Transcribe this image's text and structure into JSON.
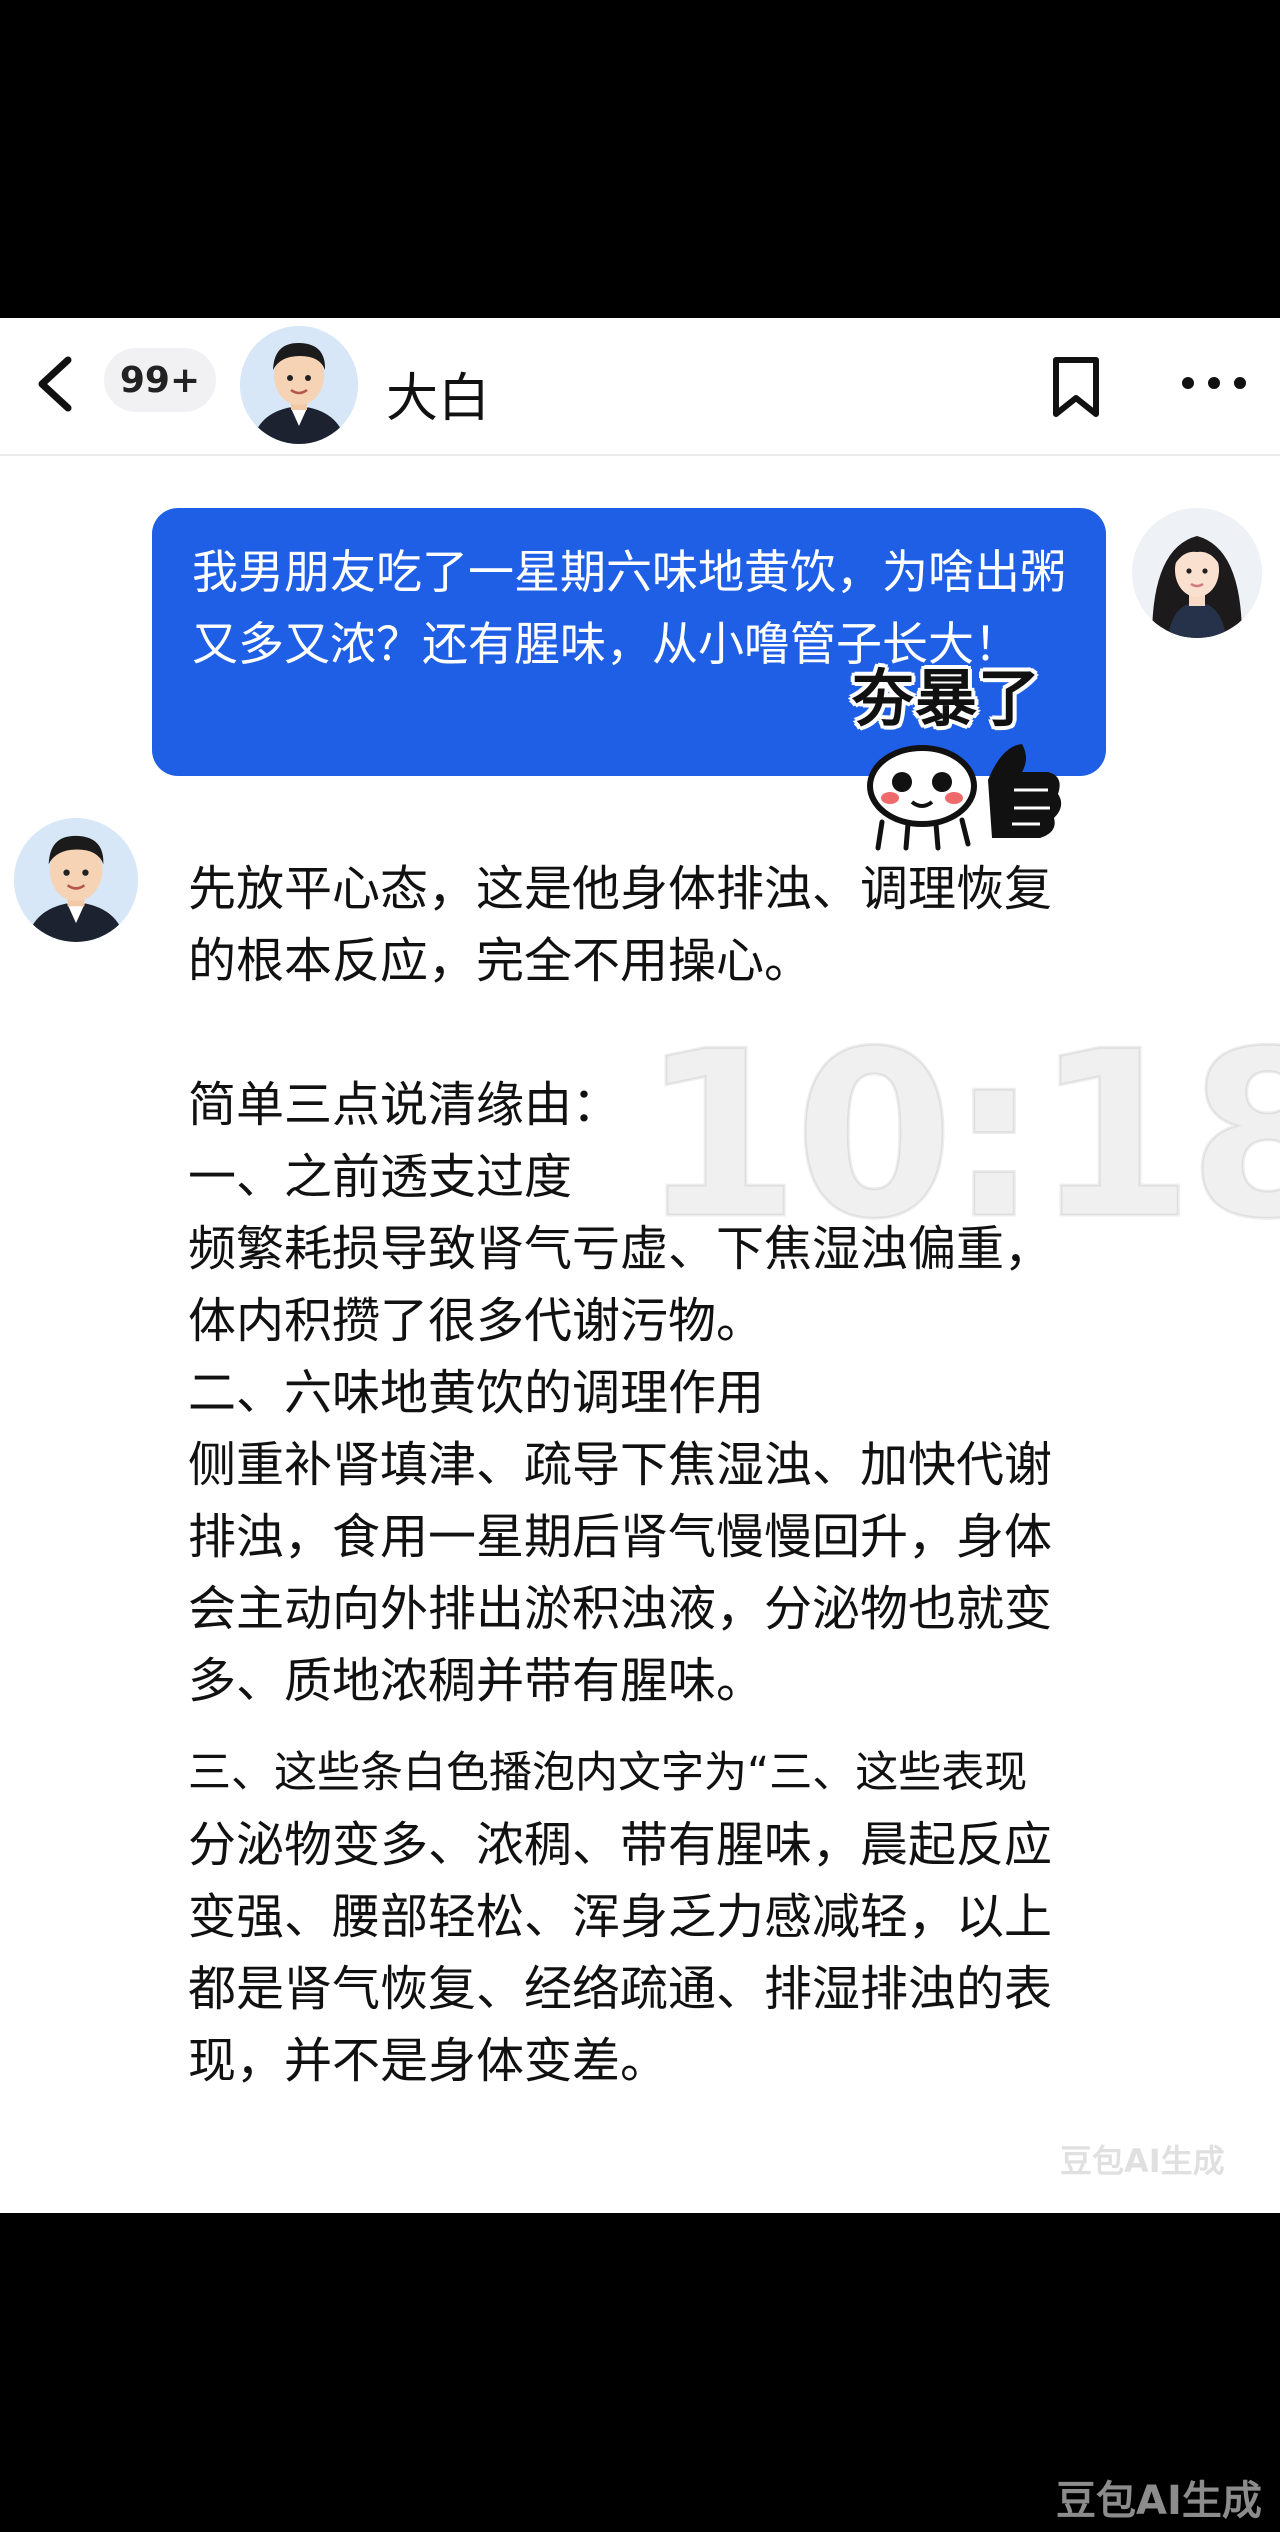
{
  "header": {
    "unread_badge": "99+",
    "contact_name": "大白"
  },
  "chat": {
    "user_message": "我男朋友吃了一星期六味地黄饮，为啥出粥又多又浓？还有腥味，从小噜管子长大！",
    "sticker_text": "夯暴了",
    "reply": {
      "intro": "先放平心态，这是他身体排浊、调理恢复的根本反应，完全不用操心。",
      "list_title": "简单三点说清缘由：",
      "point1_title": "一、之前透支过度",
      "point1_body": "频繁耗损导致肾气亏虚、下焦湿浊偏重，体内积攒了很多代谢污物。",
      "point2_title": "二、六味地黄饮的调理作用",
      "point2_body": "侧重补肾填津、疏导下焦湿浊、加快代谢排浊，食用一星期后肾气慢慢回升，身体会主动向外排出淤积浊液，分泌物也就变多、质地浓稠并带有腥味。",
      "point3_note": "三、这些条白色播泡内文字为“三、这些表现",
      "point3_body": "分泌物变多、浓稠、带有腥味，晨起反应变强、腰部轻松、浑身乏力感减轻，以上都是肾气恢复、经络疏通、排湿排浊的表现，并不是身体变差。"
    }
  },
  "watermarks": {
    "time": "10:18",
    "inner": "豆包AI生成",
    "outer": "豆包AI生成"
  },
  "icons": [
    "back-arrow-icon",
    "bookmark-icon",
    "more-dots-icon",
    "sticker-icon"
  ]
}
